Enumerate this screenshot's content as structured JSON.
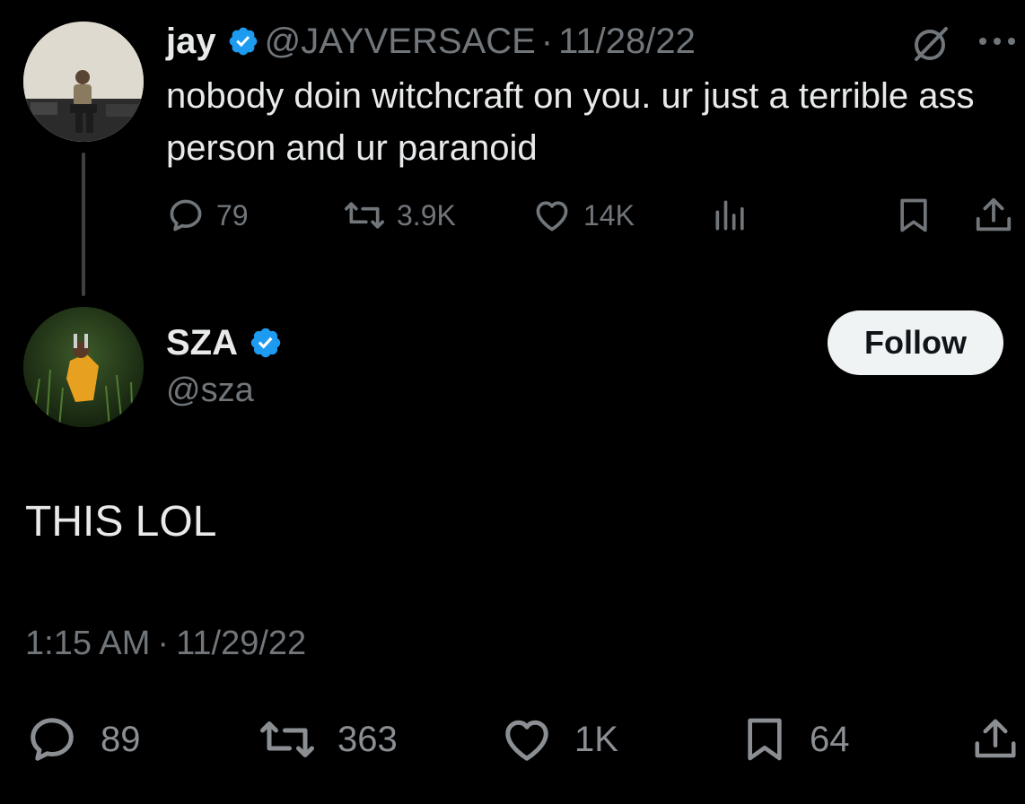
{
  "colors": {
    "background": "#000000",
    "primary_text": "#e7e9ea",
    "secondary_text": "#71767b",
    "verified_badge": "#1d9bf0",
    "follow_button_bg": "#eff3f4"
  },
  "replied_tweet": {
    "display_name": "jay",
    "verified": true,
    "handle": "@JAYVERSACE",
    "separator": "·",
    "date": "11/28/22",
    "text": "nobody doin witchcraft on you. ur just a terrible ass person and ur paranoid",
    "icons": [
      "grok-icon",
      "more-icon"
    ],
    "actions": {
      "replies": "79",
      "retweets": "3.9K",
      "likes": "14K"
    }
  },
  "main_tweet": {
    "display_name": "SZA",
    "verified": true,
    "handle": "@sza",
    "follow_label": "Follow",
    "text": "THIS LOL",
    "time": "1:15 AM",
    "separator": "·",
    "date": "11/29/22",
    "actions": {
      "replies": "89",
      "retweets": "363",
      "likes": "1K",
      "bookmarks": "64"
    }
  }
}
